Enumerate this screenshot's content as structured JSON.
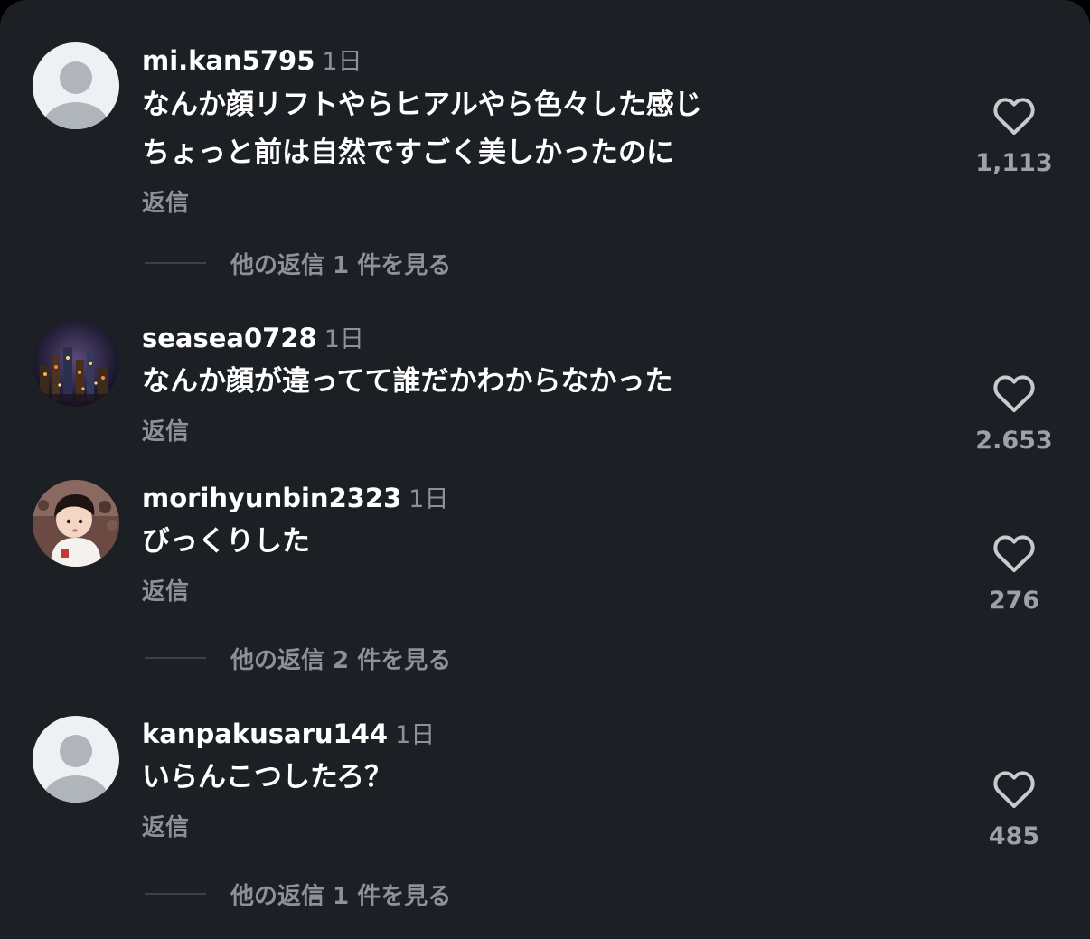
{
  "comments": [
    {
      "username": "mi.kan5795",
      "time": "1日",
      "lines": [
        "なんか顔リフトやらヒアルやら色々した感じ",
        "ちょっと前は自然ですごく美しかったのに"
      ],
      "reply_label": "返信",
      "likes": "1,113",
      "more_replies": "他の返信 1 件を見る",
      "avatar": "default-avatar"
    },
    {
      "username": "seasea0728",
      "time": "1日",
      "lines": [
        "なんか顔が違ってて誰だかわからなかった"
      ],
      "reply_label": "返信",
      "likes": "2.653",
      "avatar": "night-city-photo"
    },
    {
      "username": "morihyunbin2323",
      "time": "1日",
      "lines": [
        "びっくりした"
      ],
      "reply_label": "返信",
      "likes": "276",
      "more_replies": "他の返信 2 件を見る",
      "avatar": "child-photo"
    },
    {
      "username": "kanpakusaru144",
      "time": "1日",
      "lines": [
        "いらんこつしたろ？"
      ],
      "reply_label": "返信",
      "likes": "485",
      "more_replies": "他の返信 1 件を見る",
      "avatar": "default-avatar"
    }
  ],
  "colors": {
    "background": "#1c1f24",
    "primary_text": "#ffffff",
    "secondary_text": "#8e9198",
    "like_count": "#9ea1a8"
  }
}
